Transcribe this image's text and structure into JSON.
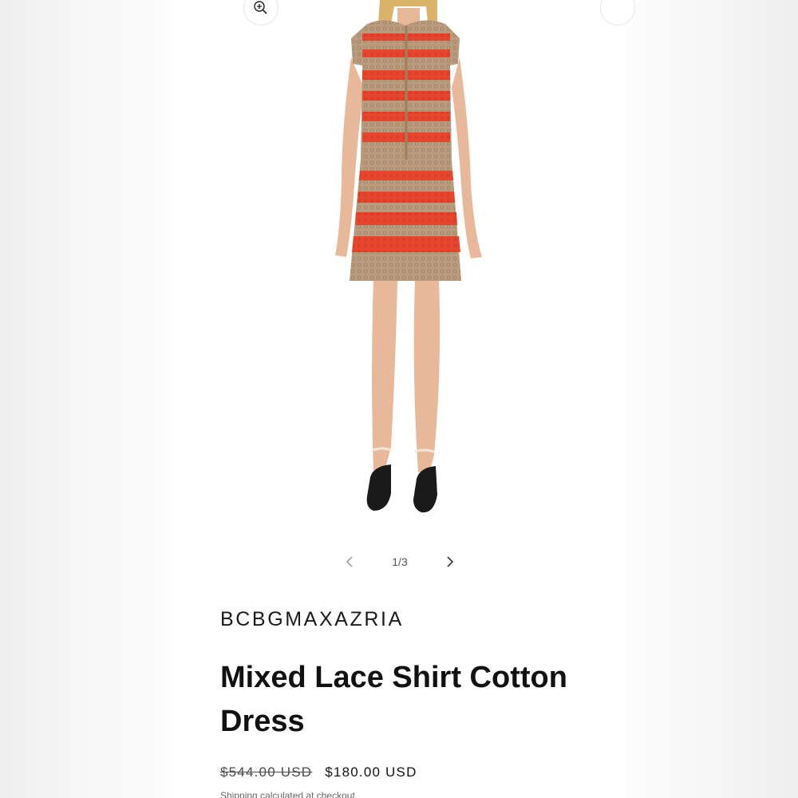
{
  "gallery": {
    "zoom_icon": "zoom-in-icon",
    "share_icon": "share-icon",
    "counter": "1/3",
    "prev_icon": "chevron-left-icon",
    "next_icon": "chevron-right-icon",
    "image_alt": "Mixed Lace Shirt Cotton Dress"
  },
  "product": {
    "vendor": "BCBGMAXAZRIA",
    "title": "Mixed Lace Shirt Cotton Dress",
    "price_compare": "$544.00 USD",
    "price_sale": "$180.00 USD",
    "tax_note": "Shipping calculated at checkout."
  },
  "colors": {
    "dress_red": "#e8452f",
    "dress_tan": "#b79a7c",
    "skin": "#e8b89a",
    "hair": "#d9b36a",
    "shoe": "#1a1a1a"
  }
}
